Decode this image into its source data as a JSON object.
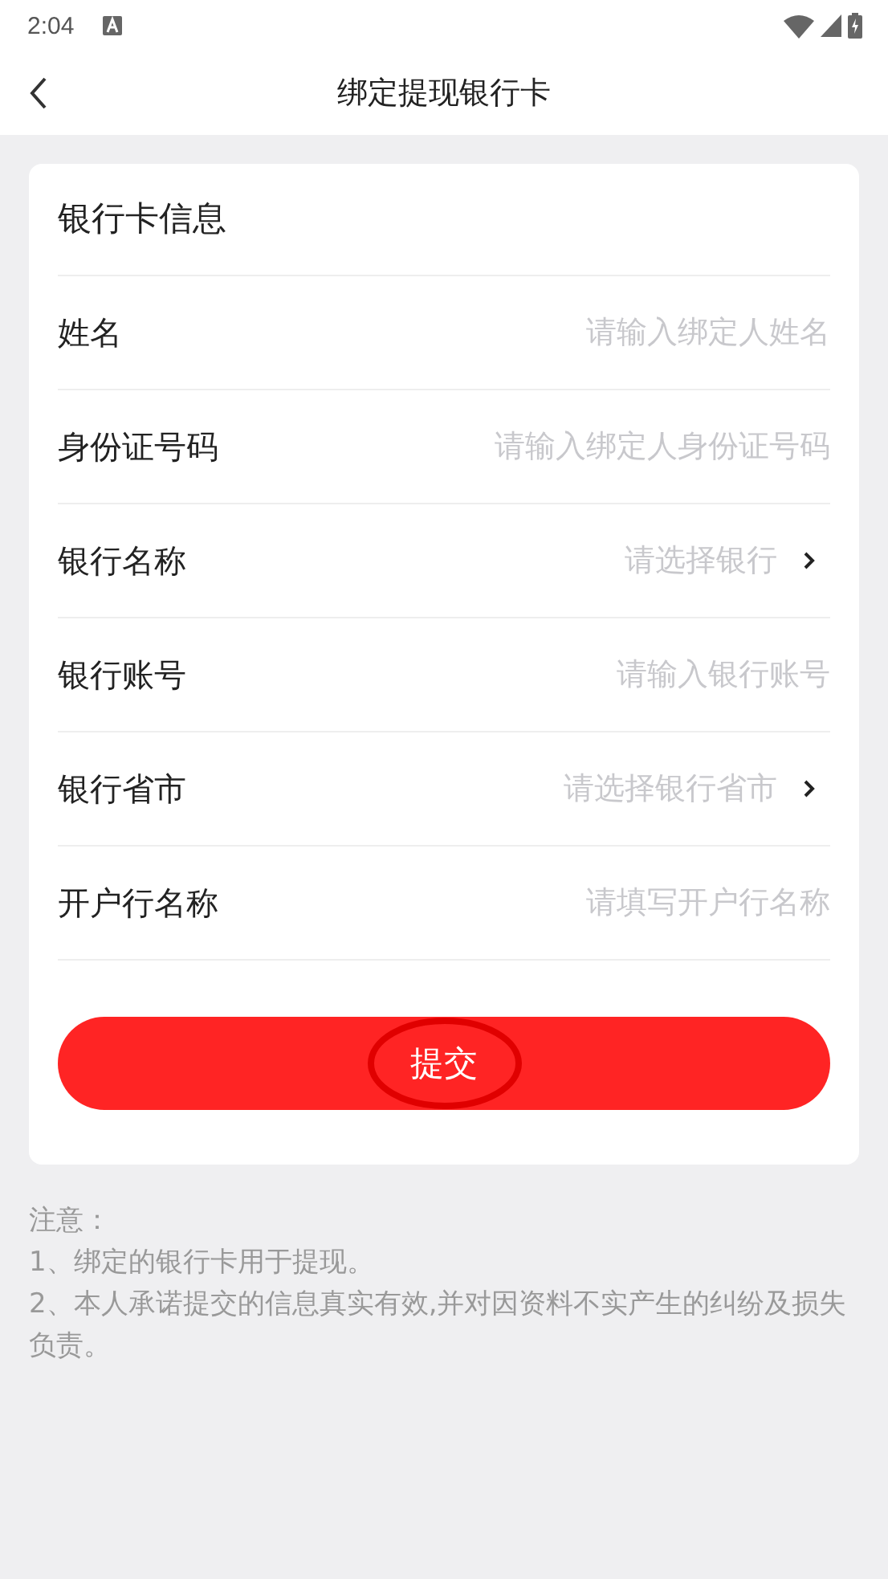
{
  "status_bar": {
    "time": "2:04"
  },
  "header": {
    "title": "绑定提现银行卡"
  },
  "card": {
    "title": "银行卡信息",
    "fields": [
      {
        "kind": "input",
        "label": "姓名",
        "placeholder": "请输入绑定人姓名"
      },
      {
        "kind": "input",
        "label": "身份证号码",
        "placeholder": "请输入绑定人身份证号码"
      },
      {
        "kind": "select",
        "label": "银行名称",
        "placeholder": "请选择银行"
      },
      {
        "kind": "input",
        "label": "银行账号",
        "placeholder": "请输入银行账号"
      },
      {
        "kind": "select",
        "label": "银行省市",
        "placeholder": "请选择银行省市"
      },
      {
        "kind": "input",
        "label": "开户行名称",
        "placeholder": "请填写开户行名称"
      }
    ],
    "submit": {
      "label": "提交",
      "circled": true
    }
  },
  "notes": [
    "注意：",
    "1、绑定的银行卡用于提现。",
    "2、本人承诺提交的信息真实有效,并对因资料不实产生的纠纷及损失负责。"
  ]
}
